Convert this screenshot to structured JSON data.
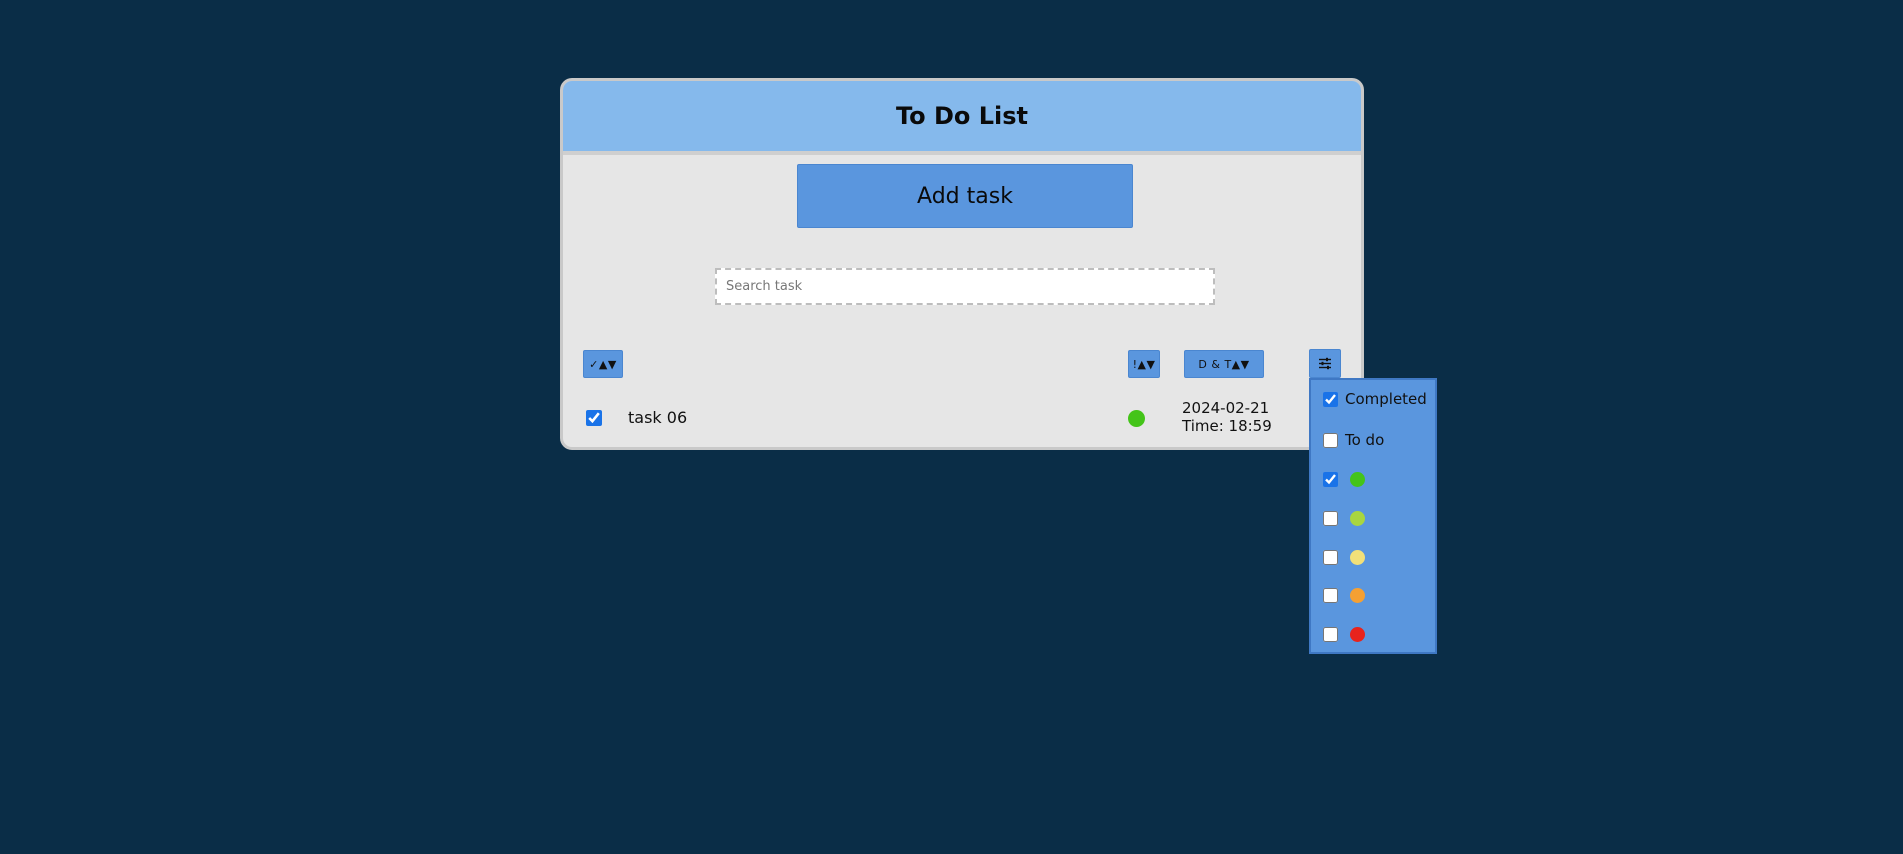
{
  "header": {
    "title": "To Do List"
  },
  "actions": {
    "add_label": "Add task"
  },
  "search": {
    "placeholder": "Search task"
  },
  "sort": {
    "completed_label": "✓▲▼",
    "priority_label": "!▲▼",
    "date_label": "D & T▲▼"
  },
  "filter": {
    "icon": "sliders-icon",
    "options": [
      {
        "label": "Completed",
        "checked": true
      },
      {
        "label": "To do",
        "checked": false
      }
    ],
    "priorities": [
      {
        "color": "#44c419",
        "checked": true
      },
      {
        "color": "#a8d640",
        "checked": false
      },
      {
        "color": "#f2e079",
        "checked": false
      },
      {
        "color": "#f5a033",
        "checked": false
      },
      {
        "color": "#e8231c",
        "checked": false
      }
    ]
  },
  "tasks": [
    {
      "name": "task 06",
      "completed": true,
      "priority_color": "#44c419",
      "date": "2024-02-21",
      "time": "Time: 18:59"
    }
  ]
}
